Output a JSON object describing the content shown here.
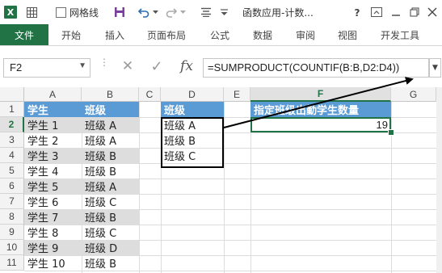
{
  "titlebar": {
    "app_logo": "X",
    "gridlines_label": "网格线",
    "gridlines_checked": false,
    "window_title": "函数应用-计数..."
  },
  "ribbon": {
    "file_tab": "文件",
    "tabs": [
      "开始",
      "插入",
      "页面布局",
      "公式",
      "数据",
      "审阅",
      "视图",
      "开发工具"
    ],
    "accent_color": "#217346"
  },
  "formula_bar": {
    "name_box": "F2",
    "cancel_symbol": "✕",
    "enter_symbol": "✓",
    "fx_label": "fx",
    "formula": "=SUMPRODUCT(COUNTIF(B:B,D2:D4))"
  },
  "grid": {
    "columns": [
      "A",
      "B",
      "C",
      "D",
      "E",
      "F",
      "G"
    ],
    "active_column": "F",
    "rows": [
      "1",
      "2",
      "3",
      "4",
      "5",
      "6",
      "7",
      "8",
      "9",
      "10",
      "11"
    ],
    "active_row": "2",
    "header_fill": "#5b9bd5",
    "band_fill": "#dddddd"
  },
  "table_students": {
    "headers": [
      "学生",
      "班级"
    ],
    "rows": [
      [
        "学生 1",
        "班级 A"
      ],
      [
        "学生 2",
        "班级 A"
      ],
      [
        "学生 3",
        "班级 B"
      ],
      [
        "学生 4",
        "班级 B"
      ],
      [
        "学生 5",
        "班级 A"
      ],
      [
        "学生 6",
        "班级 C"
      ],
      [
        "学生 7",
        "班级 B"
      ],
      [
        "学生 8",
        "班级 C"
      ],
      [
        "学生 9",
        "班级 D"
      ],
      [
        "学生 10",
        "班级 B"
      ]
    ]
  },
  "table_classes": {
    "header": "班级",
    "rows": [
      "班级 A",
      "班级 B",
      "班级 C"
    ]
  },
  "result": {
    "header": "指定班级出勤学生数量",
    "value": "19"
  }
}
